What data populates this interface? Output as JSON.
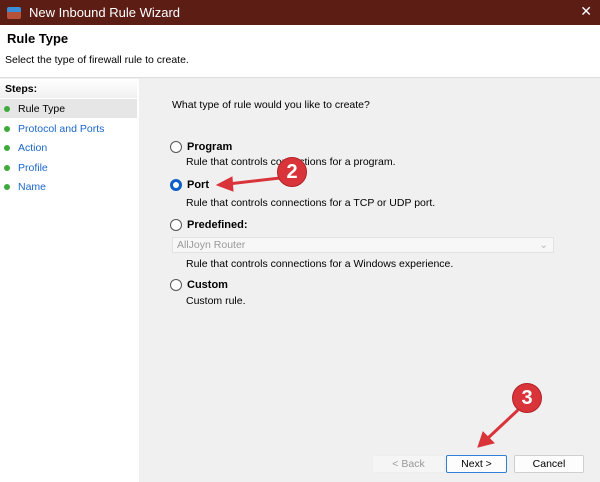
{
  "window": {
    "title": "New Inbound Rule Wizard",
    "close": "✕"
  },
  "header": {
    "title": "Rule Type",
    "subtitle": "Select the type of firewall rule to create."
  },
  "steps": {
    "heading": "Steps:",
    "items": [
      {
        "label": "Rule Type"
      },
      {
        "label": "Protocol and Ports"
      },
      {
        "label": "Action"
      },
      {
        "label": "Profile"
      },
      {
        "label": "Name"
      }
    ]
  },
  "main": {
    "question": "What type of rule would you like to create?",
    "options": [
      {
        "label": "Program",
        "desc": "Rule that controls connections for a program.",
        "selected": false
      },
      {
        "label": "Port",
        "desc": "Rule that controls connections for a TCP or UDP port.",
        "selected": true
      },
      {
        "label": "Predefined:",
        "desc": "Rule that controls connections for a Windows experience.",
        "selected": false
      },
      {
        "label": "Custom",
        "desc": "Custom rule.",
        "selected": false
      }
    ],
    "predefined_value": "AllJoyn Router"
  },
  "buttons": {
    "back": "< Back",
    "next": "Next >",
    "cancel": "Cancel"
  },
  "annotations": {
    "badge2": "2",
    "badge3": "3",
    "color": "#d9343a"
  }
}
